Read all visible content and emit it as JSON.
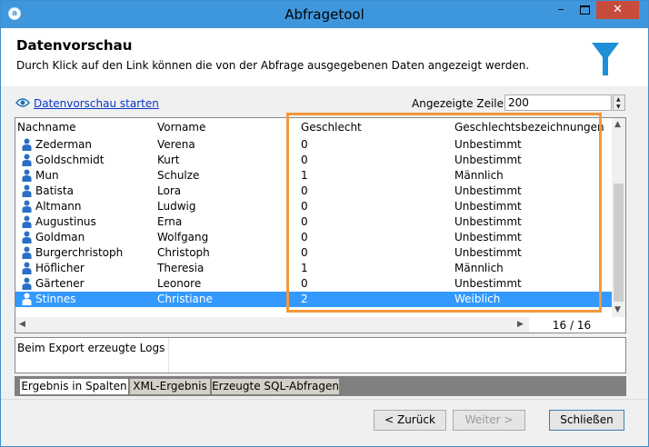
{
  "window": {
    "title": "Abfragetool",
    "icon": "app-icon",
    "controls": [
      "minimize",
      "maximize",
      "close"
    ]
  },
  "header": {
    "title": "Datenvorschau",
    "description": "Durch Klick auf den Link können die von der Abfrage ausgegebenen Daten angezeigt werden.",
    "icon": "funnel-icon",
    "icon_color": "#1e8fd8"
  },
  "toolbar": {
    "link_label": "Datenvorschau starten",
    "rows_label": "Angezeigte Zeilen:",
    "rows_value": "200"
  },
  "grid": {
    "columns": [
      "Nachname",
      "Vorname",
      "Geschlecht",
      "Geschlechtsbezeichnungen"
    ],
    "rows": [
      {
        "nachname": "Zederman",
        "vorname": "Verena",
        "geschlecht": "0",
        "bezeichnung": "Unbestimmt"
      },
      {
        "nachname": "Goldschmidt",
        "vorname": "Kurt",
        "geschlecht": "0",
        "bezeichnung": "Unbestimmt"
      },
      {
        "nachname": "Mun",
        "vorname": "Schulze",
        "geschlecht": "1",
        "bezeichnung": "Männlich"
      },
      {
        "nachname": "Batista",
        "vorname": "Lora",
        "geschlecht": "0",
        "bezeichnung": "Unbestimmt"
      },
      {
        "nachname": "Altmann",
        "vorname": "Ludwig",
        "geschlecht": "0",
        "bezeichnung": "Unbestimmt"
      },
      {
        "nachname": "Augustinus",
        "vorname": "Erna",
        "geschlecht": "0",
        "bezeichnung": "Unbestimmt"
      },
      {
        "nachname": "Goldman",
        "vorname": "Wolfgang",
        "geschlecht": "0",
        "bezeichnung": "Unbestimmt"
      },
      {
        "nachname": "Burgerchristoph",
        "vorname": "Christoph",
        "geschlecht": "0",
        "bezeichnung": "Unbestimmt"
      },
      {
        "nachname": "Höflicher",
        "vorname": "Theresia",
        "geschlecht": "1",
        "bezeichnung": "Männlich"
      },
      {
        "nachname": "Gärtener",
        "vorname": "Leonore",
        "geschlecht": "0",
        "bezeichnung": "Unbestimmt"
      },
      {
        "nachname": "Stinnes",
        "vorname": "Christiane",
        "geschlecht": "2",
        "bezeichnung": "Weiblich"
      }
    ],
    "selected_row": "Stinnes",
    "selection_color": "#3399ff",
    "highlight_color": "#f4973b",
    "row_icon": "person-icon",
    "row_count": "16 / 16"
  },
  "logs": {
    "label": "Beim Export erzeugte Logs"
  },
  "tabs": [
    {
      "label": "Ergebnis in Spalten",
      "active": true
    },
    {
      "label": "XML-Ergebnis",
      "active": false
    },
    {
      "label": "Erzeugte SQL-Abfragen",
      "active": false
    }
  ],
  "footer": {
    "back": "< Zurück",
    "next": "Weiter >",
    "close": "Schließen"
  }
}
